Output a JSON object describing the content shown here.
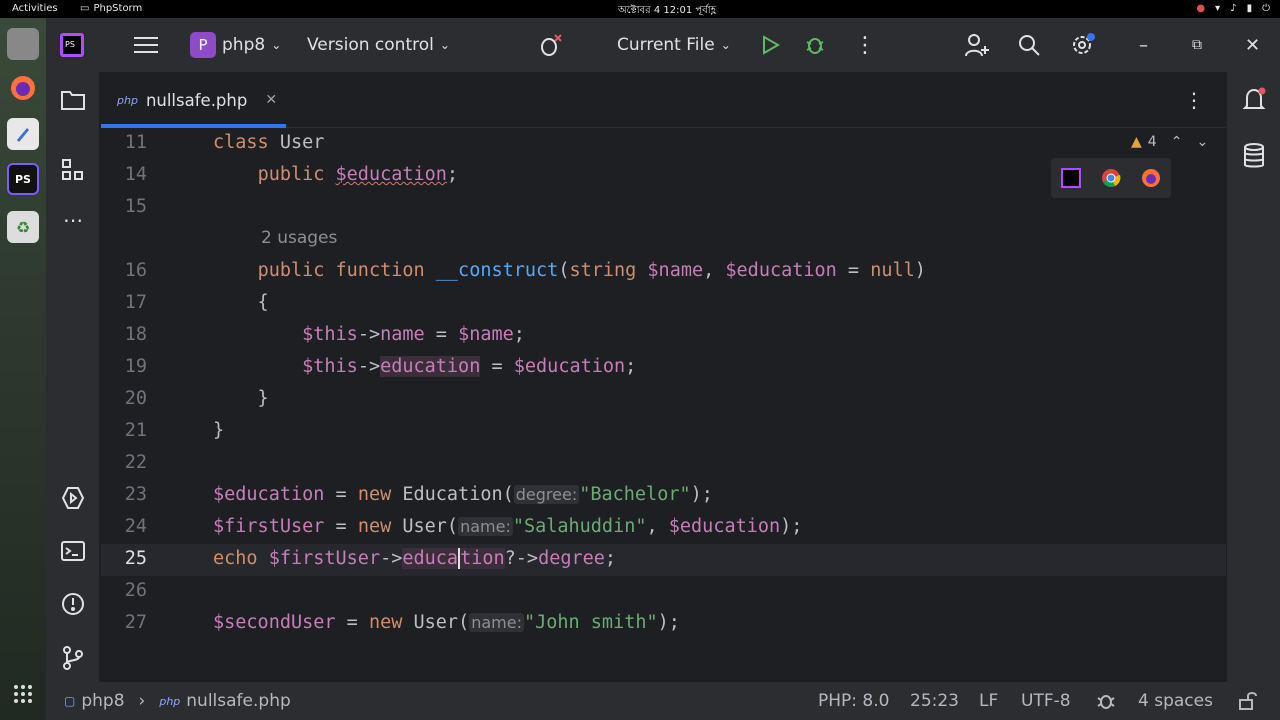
{
  "topbar": {
    "activities": "Activities",
    "app_name": "PhpStorm",
    "clock": "অক্টোবর 4  12:01 পূর্বাহ্ণ"
  },
  "titlebar": {
    "project_badge": "P",
    "project_name": "php8",
    "vcs_label": "Version control",
    "run_config": "Current File"
  },
  "tab": {
    "lang_badge": "php",
    "filename": "nullsafe.php"
  },
  "inspection": {
    "warning_count": "4"
  },
  "editor": {
    "usages_hint": "2 usages",
    "lines": [
      {
        "n": "11"
      },
      {
        "n": "14"
      },
      {
        "n": "15"
      },
      {
        "n": ""
      },
      {
        "n": "16"
      },
      {
        "n": "17"
      },
      {
        "n": "18"
      },
      {
        "n": "19"
      },
      {
        "n": "20"
      },
      {
        "n": "21"
      },
      {
        "n": "22"
      },
      {
        "n": "23"
      },
      {
        "n": "24"
      },
      {
        "n": "25"
      },
      {
        "n": "26"
      },
      {
        "n": "27"
      }
    ],
    "hints": {
      "degree": "degree:",
      "name1": "name:",
      "name2": "name:"
    },
    "strings": {
      "bachelor": "\"Bachelor\"",
      "salahuddin": "\"Salahuddin\"",
      "john": "\"John smith\""
    }
  },
  "statusbar": {
    "project": "php8",
    "file": "nullsafe.php",
    "php_version": "PHP: 8.0",
    "position": "25:23",
    "line_sep": "LF",
    "encoding": "UTF-8",
    "indent": "4 spaces"
  },
  "colors": {
    "accent": "#3574f0",
    "keyword": "#cf8e6d",
    "variable": "#c77dbb",
    "function": "#56a8f5",
    "string": "#6aab73"
  }
}
